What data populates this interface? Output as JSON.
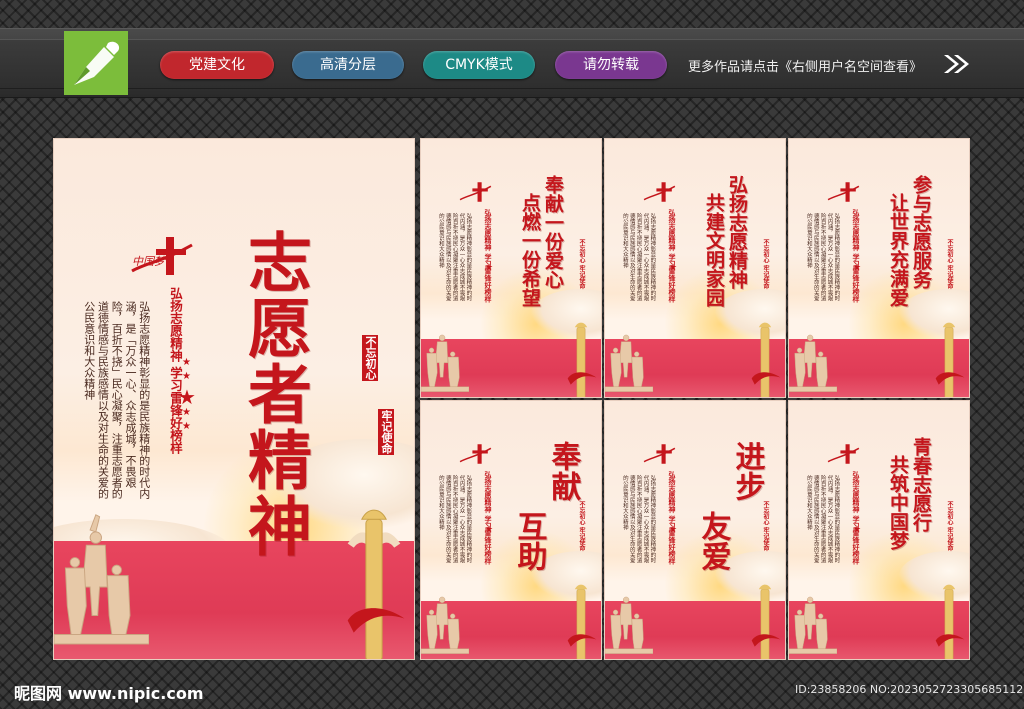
{
  "header": {
    "tags": [
      "党建文化",
      "高清分层",
      "CMYK模式",
      "请勿转载"
    ],
    "more_text": "更多作品请点击《右侧用户名空间查看》",
    "colors": {
      "tag1": "#c1272d",
      "tag2": "#3a6b8f",
      "tag3": "#1d8a86",
      "tag4": "#7a3790",
      "logo": "#7cbd3b"
    }
  },
  "main_poster": {
    "brand": "中国梦",
    "title": "志愿者精神",
    "subtitle": "弘扬志愿精神 学习雷锋好榜样",
    "body": "弘扬志愿精神彰显的是民族精神的时代内涵，是「万众一心、众志成城，不畏艰险，百折不挠」民心凝聚，注重志愿者的道德情感与民族感情以及对生命的关爱的公民意识和大众精神",
    "seal_left": "不忘初心",
    "seal_right": "牢记使命"
  },
  "posters": [
    {
      "title_lines": [
        "奉献一份爱心",
        "点燃一份希望"
      ],
      "subtitle": "弘扬志愿精神 学习雷锋好榜样"
    },
    {
      "title_lines": [
        "弘扬志愿精神",
        "共建文明家园"
      ],
      "subtitle": "弘扬志愿精神 学习雷锋好榜样"
    },
    {
      "title_lines": [
        "参与志愿服务",
        "让世界充满爱"
      ],
      "subtitle": "弘扬志愿精神 学习雷锋好榜样"
    },
    {
      "title_lines": [
        "奉献",
        "互助"
      ],
      "subtitle": "弘扬志愿精神 学习雷锋好榜样"
    },
    {
      "title_lines": [
        "进步",
        "友爱"
      ],
      "subtitle": "弘扬志愿精神 学习雷锋好榜样"
    },
    {
      "title_lines": [
        "青春志愿行",
        "共筑中国梦"
      ],
      "subtitle": "弘扬志愿精神 学习雷锋好榜样"
    }
  ],
  "small_body": "弘扬志愿精神彰显的是民族精神的时代内涵，是万众一心众志成城不畏艰险百折不挠民心凝聚注重志愿者的道德情感与民族感情以及对生命的关爱的公民意识和大众精神",
  "small_seal": "不忘初心 牢记使命",
  "footer": {
    "site": "昵图网 www.nipic.com",
    "id_text": "ID:23858206 NO:20230527233056851120"
  }
}
